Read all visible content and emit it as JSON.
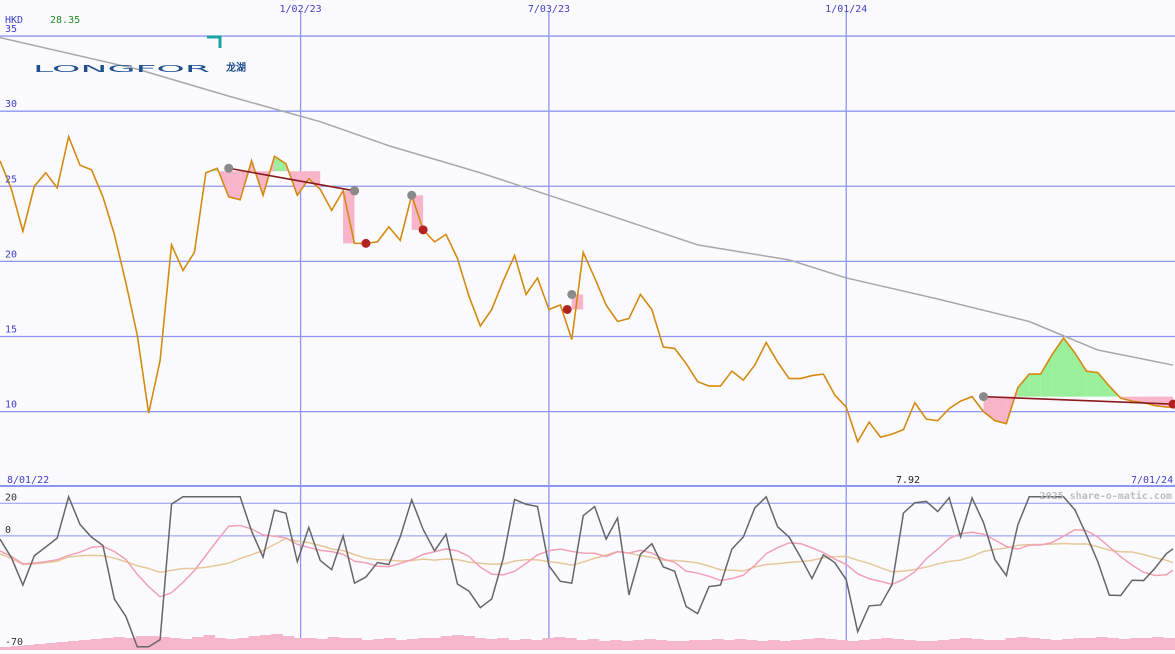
{
  "colors": {
    "background": "#fbfbff",
    "grid": "#8c96f0",
    "tick_text": "#3f3fc8",
    "price_line": "#d48a10",
    "ma_line": "#a8a8a8",
    "trend_line": "#8b1a1a",
    "pink_fill": "#f8b4c8",
    "green_fill": "#9af09a",
    "marker_grey": "#8a8a8a",
    "marker_red": "#b22222",
    "osc_line": "#666666",
    "osc_pink": "#f2a0b4",
    "osc_tan": "#e6c898",
    "volume": "#f6b6cc",
    "logo_blue": "#1f4f8f",
    "logo_teal": "#1aa3a3",
    "last_price_color": "#228b22"
  },
  "header": {
    "currency": "HKD",
    "last_price": "28.35"
  },
  "logo": {
    "brand": "LONGFOR",
    "cjk": "龙湖"
  },
  "footer": {
    "start_date": "8/01/22",
    "low_label": "7.92",
    "end_date": "7/01/24"
  },
  "watermark": "2025 share-o-matic.com",
  "chart_data": {
    "type": "line",
    "x_axis": {
      "type": "date",
      "range": [
        "2022-08-01",
        "2024-07-19"
      ],
      "tick_labels": [
        "1/02/23",
        "7/03/23",
        "1/01/24"
      ]
    },
    "y_axis": {
      "ticks": [
        10,
        15,
        20,
        25,
        30,
        35
      ],
      "range": [
        5.05,
        37.4
      ]
    },
    "grid": true,
    "series": [
      {
        "kind": "price",
        "x": [
          "2022-08-01",
          "2022-08-08",
          "2022-08-15",
          "2022-08-22",
          "2022-08-29",
          "2022-09-05",
          "2022-09-12",
          "2022-09-19",
          "2022-09-26",
          "2022-10-03",
          "2022-10-10",
          "2022-10-17",
          "2022-10-24",
          "2022-10-31",
          "2022-11-07",
          "2022-11-14",
          "2022-11-21",
          "2022-11-28",
          "2022-12-05",
          "2022-12-12",
          "2022-12-19",
          "2022-12-26",
          "2023-01-02",
          "2023-01-09",
          "2023-01-16",
          "2023-01-23",
          "2023-01-30",
          "2023-02-06",
          "2023-02-13",
          "2023-02-20",
          "2023-02-27",
          "2023-03-06",
          "2023-03-13",
          "2023-03-20",
          "2023-03-27",
          "2023-04-03",
          "2023-04-10",
          "2023-04-17",
          "2023-04-24",
          "2023-05-01",
          "2023-05-08",
          "2023-05-15",
          "2023-05-22",
          "2023-05-29",
          "2023-06-05",
          "2023-06-12",
          "2023-06-19",
          "2023-06-26",
          "2023-07-03",
          "2023-07-10",
          "2023-07-17",
          "2023-07-24",
          "2023-07-31",
          "2023-08-07",
          "2023-08-14",
          "2023-08-21",
          "2023-08-28",
          "2023-09-04",
          "2023-09-11",
          "2023-09-18",
          "2023-09-25",
          "2023-10-02",
          "2023-10-09",
          "2023-10-16",
          "2023-10-23",
          "2023-10-30",
          "2023-11-06",
          "2023-11-13",
          "2023-11-20",
          "2023-11-27",
          "2023-12-04",
          "2023-12-11",
          "2023-12-18",
          "2023-12-25",
          "2024-01-01",
          "2024-01-08",
          "2024-01-15",
          "2024-01-22",
          "2024-01-29",
          "2024-02-05",
          "2024-02-12",
          "2024-02-19",
          "2024-02-26",
          "2024-03-04",
          "2024-03-11",
          "2024-03-18",
          "2024-03-25",
          "2024-04-01",
          "2024-04-08",
          "2024-04-15",
          "2024-04-22",
          "2024-04-29",
          "2024-05-06",
          "2024-05-13",
          "2024-05-20",
          "2024-05-27",
          "2024-06-03",
          "2024-06-10",
          "2024-06-17",
          "2024-06-24",
          "2024-07-01",
          "2024-07-08",
          "2024-07-15",
          "2024-07-19"
        ],
        "y": [
          26.7,
          24.8,
          22.0,
          25.0,
          25.9,
          24.9,
          28.3,
          26.4,
          26.1,
          24.3,
          21.8,
          18.6,
          15.1,
          9.9,
          13.4,
          21.1,
          19.4,
          20.6,
          25.9,
          26.2,
          24.3,
          24.1,
          26.7,
          24.4,
          27.0,
          26.5,
          24.4,
          25.5,
          24.8,
          23.4,
          24.7,
          21.2,
          21.2,
          21.3,
          22.3,
          21.4,
          24.4,
          22.1,
          21.3,
          21.8,
          20.2,
          17.7,
          15.7,
          16.8,
          18.7,
          20.4,
          17.8,
          18.9,
          16.8,
          17.1,
          14.8,
          20.6,
          18.9,
          17.1,
          16.0,
          16.2,
          17.8,
          16.8,
          14.3,
          14.2,
          13.2,
          12.0,
          11.7,
          11.7,
          12.7,
          12.1,
          13.1,
          14.6,
          13.3,
          12.2,
          12.2,
          12.4,
          12.5,
          11.1,
          10.3,
          8.0,
          9.3,
          8.3,
          8.5,
          8.8,
          10.6,
          9.5,
          9.4,
          10.2,
          10.7,
          11.0,
          10.0,
          9.4,
          9.2,
          11.6,
          12.5,
          12.5,
          13.8,
          14.9,
          13.9,
          12.7,
          12.6,
          11.7,
          10.9,
          10.7,
          10.6,
          10.4,
          10.3,
          10.3
        ]
      },
      {
        "kind": "moving_average",
        "x": [
          "2022-08-01",
          "2022-10-24",
          "2022-12-19",
          "2023-02-13",
          "2023-03-27",
          "2023-05-22",
          "2023-07-31",
          "2023-10-02",
          "2023-11-27",
          "2024-01-01",
          "2024-02-26",
          "2024-04-22",
          "2024-06-03",
          "2024-07-19"
        ],
        "y": [
          34.9,
          32.8,
          31.0,
          29.3,
          27.7,
          25.9,
          23.4,
          21.1,
          20.1,
          18.9,
          17.5,
          16.0,
          14.1,
          13.1
        ]
      }
    ],
    "annotations": [
      {
        "type": "trend",
        "from": {
          "x": "2022-12-19",
          "y": 26.2
        },
        "to": {
          "x": "2023-03-06",
          "y": 24.7
        }
      },
      {
        "type": "trend",
        "from": {
          "x": "2024-03-25",
          "y": 11.0
        },
        "to": {
          "x": "2024-07-19",
          "y": 10.5
        }
      }
    ],
    "lower_panel": {
      "oscillator_ticks": [
        20,
        0,
        -70
      ],
      "oscillator_range": [
        -70,
        30
      ]
    }
  }
}
